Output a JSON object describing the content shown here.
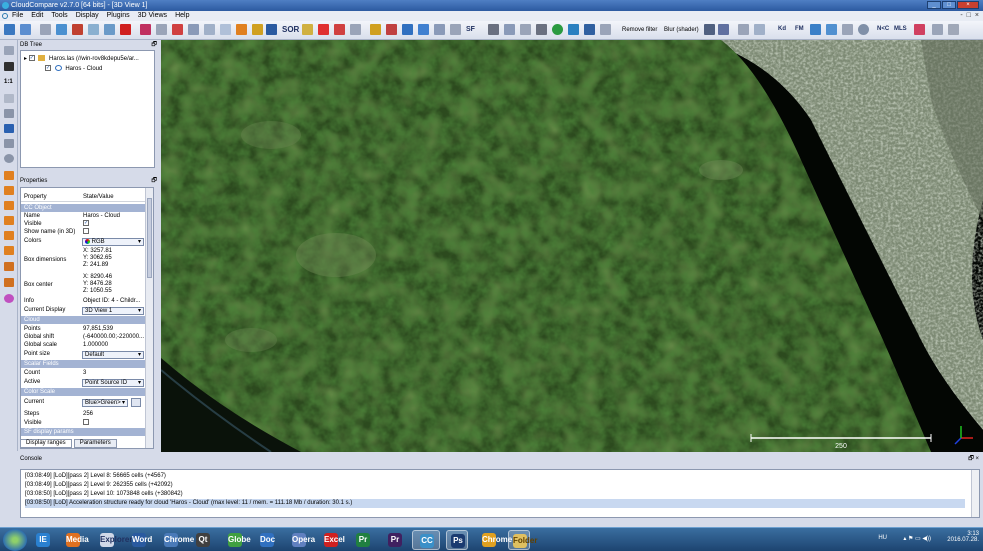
{
  "window": {
    "title": "CloudCompare v2.7.0 [64 bits] - [3D View 1]",
    "buttons": [
      "_",
      "□",
      "×"
    ]
  },
  "menu": {
    "items": [
      "File",
      "Edit",
      "Tools",
      "Display",
      "Plugins",
      "3D Views",
      "Help"
    ],
    "right_controls": [
      "-",
      "□",
      "×"
    ]
  },
  "toolbar": {
    "sor_label": "SOR",
    "remove_filter": "Remove filter",
    "blur_shader": "Blur (shader)",
    "sf_label": "SF",
    "kd_label": "Kd",
    "fm_label": "FM",
    "nc_label": "N<C",
    "mls_label": "MLS"
  },
  "left_toolbar": {
    "scale_label": "1:1"
  },
  "db_tree": {
    "title": "DB Tree",
    "float_btn": "🗗",
    "file_node": "Haros.las (//win-rov8kdepu5e/ar...",
    "cloud_node": "Haros - Cloud"
  },
  "properties": {
    "title": "Properties",
    "float_btn": "🗗",
    "header_property": "Property",
    "header_value": "State/Value",
    "sections": {
      "cc_object": "CC Object",
      "cloud": "Cloud",
      "scalar_fields": "Scalar Fields",
      "color_scale": "Color Scale",
      "sf_display": "SF display params"
    },
    "name_k": "Name",
    "name_v": "Haros - Cloud",
    "visible_k": "Visible",
    "showname_k": "Show name (in 3D)",
    "colors_k": "Colors",
    "colors_v": "RGB",
    "boxdim_k": "Box dimensions",
    "boxdim_x": "X: 3257.81",
    "boxdim_y": "Y: 3062.65",
    "boxdim_z": "Z: 241.89",
    "boxcenter_k": "Box center",
    "boxcenter_x": "X: 8290.46",
    "boxcenter_y": "Y: 8476.28",
    "boxcenter_z": "Z: 1050.55",
    "info_k": "Info",
    "info_v": "Object ID: 4 - Childr...",
    "curdisp_k": "Current Display",
    "curdisp_v": "3D View 1",
    "points_k": "Points",
    "points_v": "97,851,539",
    "gshift_k": "Global shift",
    "gshift_v": "(-640000.00;-220000...",
    "gscale_k": "Global scale",
    "gscale_v": "1.000000",
    "psize_k": "Point size",
    "psize_v": "Default",
    "count_k": "Count",
    "count_v": "3",
    "active_k": "Active",
    "active_v": "Point Source ID",
    "current_k": "Current",
    "current_v": "Blue>Green>",
    "steps_k": "Steps",
    "steps_v": "256",
    "visible2_k": "Visible",
    "tab1": "Display ranges",
    "tab2": "Parameters"
  },
  "view": {
    "scale_value": "250"
  },
  "console": {
    "title": "Console",
    "float_btn": "🗗 ×",
    "lines": [
      "[03:08:49] [LoD][pass 2] Level 8: 56665 cells (+4567)",
      "[03:08:49] [LoD][pass 2] Level 9: 262355 cells (+42092)",
      "[03:08:50] [LoD][pass 2] Level 10: 1073848 cells (+380842)",
      "[03:08:50] [LoD] Acceleration structure ready for cloud 'Haros - Cloud' (max level: 11 / mem. = 111.18 Mb / duration: 30.1 s.)"
    ]
  },
  "taskbar": {
    "apps": [
      "IE",
      "Media",
      "Explorer",
      "Word",
      "Chrome",
      "Qt",
      "Globe",
      "Doc",
      "Opera",
      "Excel",
      "Pr",
      "CC",
      "Ps",
      "Chrome",
      "Folder"
    ],
    "tray_lang": "HU",
    "time": "3:13",
    "date": "2016.07.28."
  },
  "colors": {
    "title_bar": "#2c5aa0",
    "chrome_bg": "#d6dbe9",
    "section_header": "#a3b3d3",
    "taskbar": "#1d4470"
  }
}
